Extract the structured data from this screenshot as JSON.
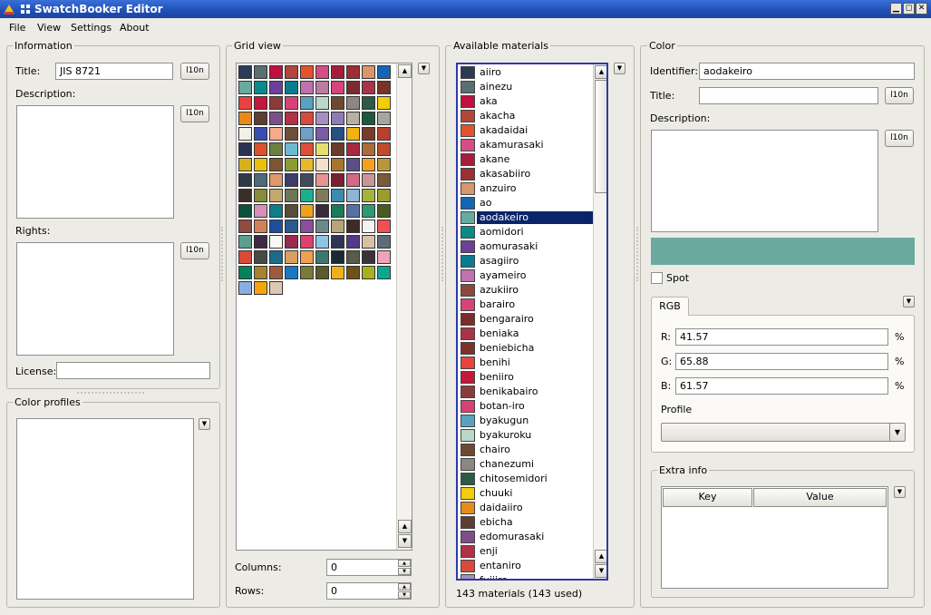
{
  "window": {
    "title": "SwatchBooker Editor",
    "min_glyph": "▁",
    "max_glyph": "◻",
    "close_glyph": "✕"
  },
  "menu": [
    "File",
    "View",
    "Settings",
    "About"
  ],
  "information": {
    "group_title": "Information",
    "title_label": "Title:",
    "title_value": "JIS 8721",
    "l10n_label": "l10n",
    "description_label": "Description:",
    "rights_label": "Rights:",
    "license_label": "License:",
    "license_value": ""
  },
  "color_profiles": {
    "group_title": "Color profiles"
  },
  "grid_view": {
    "group_title": "Grid view",
    "columns_label": "Columns:",
    "columns_value": "0",
    "rows_label": "Rows:",
    "rows_value": "0",
    "swatches": [
      "#2b3a55",
      "#5b6e72",
      "#c0103e",
      "#b5443a",
      "#e3522d",
      "#d64d86",
      "#a61d3c",
      "#9c2f33",
      "#d9956b",
      "#1565b5",
      "#6aaa9e",
      "#0b8a8a",
      "#6d3f9a",
      "#0b7c8e",
      "#bf71b0",
      "#b97ea0",
      "#d6447a",
      "#7c2c2a",
      "#a9344a",
      "#7a3328",
      "#e8443f",
      "#c2183a",
      "#8a3c3a",
      "#d84178",
      "#5aa0c2",
      "#b8d8c8",
      "#6b4a31",
      "#8d8782",
      "#2c5a45",
      "#f2cd09",
      "#e78a1a",
      "#5e3d35",
      "#7d4f8a",
      "#b33046",
      "#d94a3e",
      "#a48fc0",
      "#8e7bb3",
      "#b7b0a3",
      "#1c5a3c",
      "#a5a6a1",
      "#f3f1e6",
      "#3b4db1",
      "#f7a98b",
      "#6e4f3b",
      "#6ea0c8",
      "#7b5aa6",
      "#264f82",
      "#f4b40f",
      "#7b3b2c",
      "#b8412e",
      "#2a3350",
      "#d9522e",
      "#6c7f3f",
      "#6fb9cf",
      "#e04e38",
      "#e4e070",
      "#6a3d2a",
      "#a52a40",
      "#ad6a3a",
      "#c04b2b",
      "#d5b21c",
      "#e8c10c",
      "#7d5533",
      "#8a9b30",
      "#e8b82d",
      "#f2e3c8",
      "#a8762a",
      "#5b4f86",
      "#f5a020",
      "#b9963a",
      "#2f3a45",
      "#4c6a7a",
      "#e09868",
      "#3c3d6b",
      "#404c5b",
      "#e8948e",
      "#7a2030",
      "#d56a84",
      "#c89696",
      "#7a5a3a",
      "#3a2e2a",
      "#858c3a",
      "#c5a86d",
      "#6d7755",
      "#1bb08d",
      "#7f7a58",
      "#3d8ab0",
      "#8fb4d8",
      "#a4b43b",
      "#9a9c2c",
      "#0e4f3b",
      "#d590b8",
      "#0a7f8a",
      "#574e3a",
      "#f0a020",
      "#3b2a3a",
      "#1a7a5a",
      "#5670a7",
      "#2c9a73",
      "#4a5a20",
      "#8e4c3e",
      "#d28058",
      "#1e4f9a",
      "#2b5890",
      "#8a4e9a",
      "#6a8a8a",
      "#b8a47a",
      "#3f2a2a",
      "#f6f2f0",
      "#f25050",
      "#5b9e8b",
      "#3d2a45",
      "#f8f8f4",
      "#9a2a50",
      "#e04070",
      "#8ec4e8",
      "#2f3455",
      "#523a8a",
      "#d8c0a8",
      "#5e6b78",
      "#d84a3a",
      "#474a45",
      "#1f6a8a",
      "#d8a060",
      "#f0a050",
      "#3a7a6e",
      "#1a2a30",
      "#585a4a",
      "#3a3438",
      "#f2a2b8",
      "#08805a",
      "#a88030",
      "#9e5a3a",
      "#1a78c0",
      "#787a3a",
      "#5a5a2a",
      "#f0b018",
      "#6e5018",
      "#a8b020",
      "#0aa890",
      "#8aaee0",
      "#f3a30b",
      "#dccab0"
    ]
  },
  "materials": {
    "group_title": "Available materials",
    "status": "143 materials (143 used)",
    "items": [
      {
        "name": "aiiro",
        "color": "#2b3a55"
      },
      {
        "name": "ainezu",
        "color": "#5b6e72"
      },
      {
        "name": "aka",
        "color": "#c0103e"
      },
      {
        "name": "akacha",
        "color": "#b5443a"
      },
      {
        "name": "akadaidai",
        "color": "#e3522d"
      },
      {
        "name": "akamurasaki",
        "color": "#d64d86"
      },
      {
        "name": "akane",
        "color": "#a61d3c"
      },
      {
        "name": "akasabiiro",
        "color": "#9c2f33"
      },
      {
        "name": "anzuiro",
        "color": "#d9956b"
      },
      {
        "name": "ao",
        "color": "#1565b5"
      },
      {
        "name": "aodakeiro",
        "color": "#6aaa9e"
      },
      {
        "name": "aomidori",
        "color": "#0b8a8a"
      },
      {
        "name": "aomurasaki",
        "color": "#6d3f9a"
      },
      {
        "name": "asagiiro",
        "color": "#0b7c8e"
      },
      {
        "name": "ayameiro",
        "color": "#bf71b0"
      },
      {
        "name": "azukiiro",
        "color": "#8a4a3a"
      },
      {
        "name": "barairo",
        "color": "#d6447a"
      },
      {
        "name": "bengarairo",
        "color": "#7c2c2a"
      },
      {
        "name": "beniaka",
        "color": "#a9344a"
      },
      {
        "name": "beniebicha",
        "color": "#7a3328"
      },
      {
        "name": "benihi",
        "color": "#e8443f"
      },
      {
        "name": "beniiro",
        "color": "#c2183a"
      },
      {
        "name": "benikabairo",
        "color": "#8a3c3a"
      },
      {
        "name": "botan-iro",
        "color": "#d84178"
      },
      {
        "name": "byakugun",
        "color": "#5aa0c2"
      },
      {
        "name": "byakuroku",
        "color": "#b8d8c8"
      },
      {
        "name": "chairo",
        "color": "#6b4a31"
      },
      {
        "name": "chanezumi",
        "color": "#8d8782"
      },
      {
        "name": "chitosemidori",
        "color": "#2c5a45"
      },
      {
        "name": "chuuki",
        "color": "#f2cd09"
      },
      {
        "name": "daidaiiro",
        "color": "#e78a1a"
      },
      {
        "name": "ebicha",
        "color": "#5e3d35"
      },
      {
        "name": "edomurasaki",
        "color": "#7d4f8a"
      },
      {
        "name": "enji",
        "color": "#b33046"
      },
      {
        "name": "entaniro",
        "color": "#d94a3e"
      },
      {
        "name": "fujiiro",
        "color": "#a48fc0"
      }
    ]
  },
  "color": {
    "group_title": "Color",
    "identifier_label": "Identifier:",
    "identifier_value": "aodakeiro",
    "title_label": "Title:",
    "title_value": "",
    "description_label": "Description:",
    "preview_color": "#6aaa9e",
    "spot_label": "Spot",
    "model_tab": "RGB",
    "r_label": "R:",
    "r_value": "41.57",
    "g_label": "G:",
    "g_value": "65.88",
    "b_label": "B:",
    "b_value": "61.57",
    "percent": "%",
    "profile_label": "Profile",
    "extra_info_title": "Extra info",
    "extra_key_header": "Key",
    "extra_value_header": "Value"
  }
}
